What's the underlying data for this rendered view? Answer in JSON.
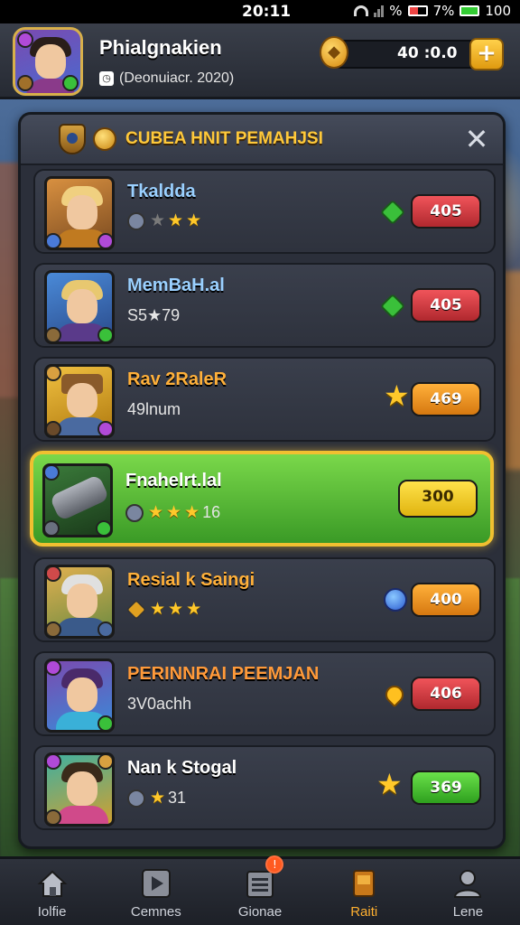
{
  "status_bar": {
    "time": "20:11",
    "battery_text": "%",
    "battery_pct": "7%",
    "battery_num": "100"
  },
  "player": {
    "name": "Phialgnakien",
    "subtitle": "(Deonuiacr. 2020)"
  },
  "currency": {
    "amount": "40 :0.0",
    "plus_label": "+"
  },
  "panel": {
    "title": "CUBEA HNIT PEMAHJSI",
    "close_label": "✕"
  },
  "heroes": [
    {
      "name": "Tkaldda",
      "sub": "",
      "stars": 3,
      "star_dim": 1,
      "price": "405",
      "price_color": "red",
      "tag": "green-diamond"
    },
    {
      "name": "MemBaH.al",
      "sub": "S5★79",
      "stars": 0,
      "star_dim": 0,
      "price": "405",
      "price_color": "red",
      "tag": "green-diamond"
    },
    {
      "name": "Rav 2RaleR",
      "sub": "49lnum",
      "stars": 0,
      "star_dim": 0,
      "price": "469",
      "price_color": "orange",
      "tag": "star"
    },
    {
      "name": "Fnahelrt.lal",
      "sub": "16",
      "stars": 3,
      "star_dim": 0,
      "price": "300",
      "price_color": "yellow",
      "tag": ""
    },
    {
      "name": "Resial k Saingi",
      "sub": "",
      "stars": 3,
      "star_dim": 0,
      "price": "400",
      "price_color": "orange",
      "tag": "blue-orb"
    },
    {
      "name": "PERINNRAI PEEMJAN",
      "sub": "3V0achh",
      "stars": 0,
      "star_dim": 0,
      "price": "406",
      "price_color": "red",
      "tag": "gold-drop"
    },
    {
      "name": "Nan k Stogal",
      "sub": "31",
      "stars": 1,
      "star_dim": 0,
      "price": "369",
      "price_color": "green",
      "tag": "star"
    }
  ],
  "nav": [
    {
      "label": "Iolfie",
      "icon": "home-icon"
    },
    {
      "label": "Cemnes",
      "icon": "play-icon"
    },
    {
      "label": "Gionae",
      "icon": "list-icon",
      "badge": "!"
    },
    {
      "label": "Raiti",
      "icon": "book-icon",
      "active": true
    },
    {
      "label": "Lene",
      "icon": "user-icon"
    }
  ],
  "colors": {
    "accent": "#ffc93a",
    "highlight": "#7ad84a",
    "active_nav": "#ffb030"
  }
}
